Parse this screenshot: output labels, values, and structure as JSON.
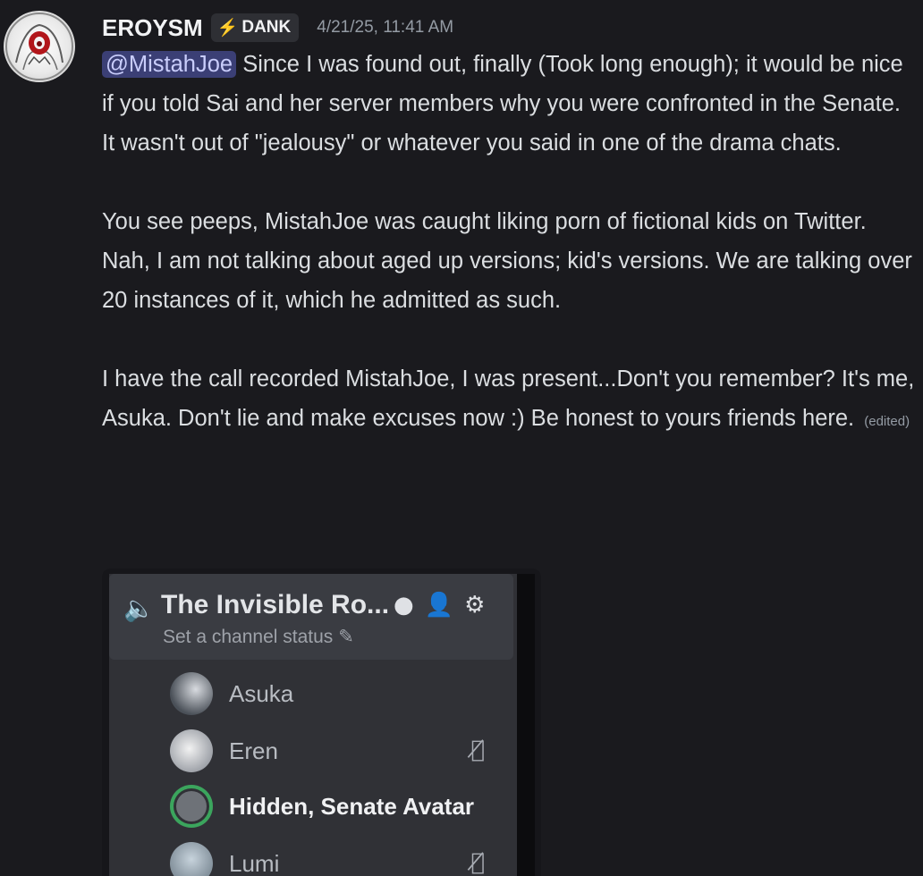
{
  "message": {
    "username": "EROYSM",
    "tag": {
      "icon": "lightning-bolt-icon",
      "label": "DANK"
    },
    "timestamp": "4/21/25, 11:41 AM",
    "paragraph1": {
      "mention": "@MistahJoe",
      "text": " Since I was found out, finally (Took long enough); it would be nice if you told Sai and her server members why you were confronted in the Senate. It wasn't out of \"jealousy\" or whatever you said in one of the drama chats."
    },
    "paragraph2": "You see peeps, MistahJoe was caught liking porn of fictional kids on Twitter. Nah, I am not talking about aged up versions; kid's versions. We are talking over 20 instances of it, which he admitted as such.",
    "paragraph3": "I have the call recorded MistahJoe, I was present...Don't you remember? It's me, Asuka. Don't lie and make excuses now :) Be honest to yours friends here.",
    "edited_label": "(edited)"
  },
  "attachment": {
    "channel_title": "The Invisible Ro...",
    "channel_status": "Set a channel status",
    "icons": [
      "speaker-icon",
      "chat-bubble-icon",
      "add-user-icon",
      "gear-icon",
      "pencil-icon"
    ],
    "members": [
      {
        "name": "Asuka",
        "muted": false,
        "bold": false
      },
      {
        "name": "Eren",
        "muted": true,
        "bold": false
      },
      {
        "name": "Hidden, Senate Avatar",
        "muted": false,
        "bold": true
      },
      {
        "name": "Lumi",
        "muted": true,
        "bold": false
      }
    ]
  },
  "colors": {
    "background": "#1a1a1e",
    "mention_bg": "#3b3f75",
    "mention_text": "#c9cdfb",
    "speaking_ring": "#3ba55d"
  }
}
